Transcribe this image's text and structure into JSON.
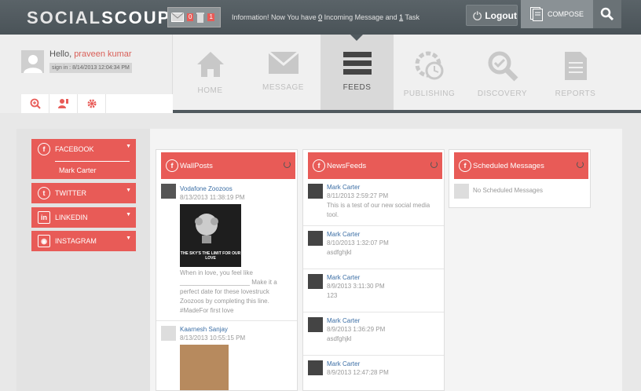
{
  "app": {
    "logo_part1": "SOCIAL",
    "logo_part2": "SCOUP"
  },
  "topbar": {
    "message_count": "0",
    "task_count": "1",
    "info_text_before": "Information! Now You have ",
    "info_msg_count": "0",
    "info_text_mid": " Incoming Message and ",
    "info_task_count": "1",
    "info_text_after": " Task",
    "logout_label": "Logout",
    "compose_label": "COMPOSE"
  },
  "user": {
    "greeting": "Hello, ",
    "name": "praveen kumar",
    "signin": "sign in : 8/14/2013 12:04:34 PM"
  },
  "nav": [
    {
      "label": "HOME",
      "icon": "home-icon"
    },
    {
      "label": "MESSAGE",
      "icon": "envelope-icon"
    },
    {
      "label": "FEEDS",
      "icon": "list-icon"
    },
    {
      "label": "PUBLISHING",
      "icon": "gear-clock-icon"
    },
    {
      "label": "DISCOVERY",
      "icon": "magnify-icon"
    },
    {
      "label": "REPORTS",
      "icon": "document-icon"
    }
  ],
  "sidebar": {
    "facebook": "FACEBOOK",
    "facebook_account": "Mark Carter",
    "twitter": "TWITTER",
    "linkedin": "LINKEDIN",
    "instagram": "INSTAGRAM"
  },
  "columns": {
    "wallposts": {
      "title": "WallPosts",
      "posts": [
        {
          "name": "Vodafone Zoozoos",
          "date": "8/13/2013 11:38:19 PM",
          "image_caption": "THE SKY'S THE LIMIT FOR OUR LOVE",
          "text": "When in love, you feel like ____________________ Make it a perfect date for these lovestruck Zoozoos by completing this line. #MadeFor first love"
        },
        {
          "name": "Kaarnesh Sanjay",
          "date": "8/13/2013 10:55:15 PM"
        }
      ]
    },
    "newsfeeds": {
      "title": "NewsFeeds",
      "posts": [
        {
          "name": "Mark Carter",
          "date": "8/11/2013 2:59:27 PM",
          "text": "This is a test of our new social media tool."
        },
        {
          "name": "Mark Carter",
          "date": "8/10/2013 1:32:07 PM",
          "text": "asdfghjkl"
        },
        {
          "name": "Mark Carter",
          "date": "8/9/2013 3:11:30 PM",
          "text": "123"
        },
        {
          "name": "Mark Carter",
          "date": "8/9/2013 1:36:29 PM",
          "text": "asdfghjkl"
        },
        {
          "name": "Mark Carter",
          "date": "8/9/2013 12:47:28 PM",
          "text": ""
        }
      ]
    },
    "scheduled": {
      "title": "Scheduled Messages",
      "empty_text": "No Scheduled Messages"
    }
  },
  "colors": {
    "accent": "#e85b57",
    "topbar": "#50595e",
    "link": "#3b6ea5"
  }
}
